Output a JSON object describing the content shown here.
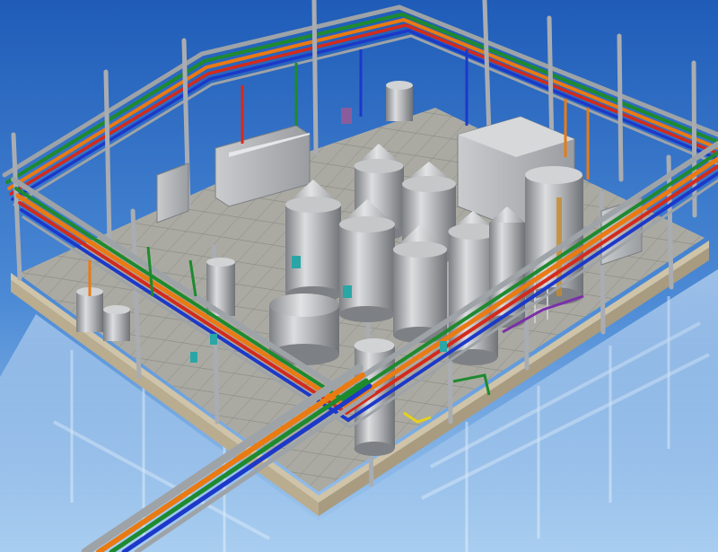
{
  "scene": {
    "subject": "3d-industrial-plant-render",
    "palette": {
      "sky_top": "#1f5cb8",
      "sky_bottom": "#9cc7ee",
      "floor_tile": "#a9a9a2",
      "floor_grout": "#8d8d86",
      "slab_edge": "#cfc3a8",
      "tank_light": "#d9dadb",
      "tank_mid": "#a8aaad",
      "tank_dark": "#7d8084",
      "pipe_steel": "#9ea3a8",
      "pipe_green": "#1e8a2e",
      "pipe_red": "#d42a1c",
      "pipe_blue": "#1c39c9",
      "pipe_orange": "#ea7a12",
      "pipe_purple": "#7a2fa8",
      "pipe_yellow": "#e5d21c",
      "reflection": "#cfe3f6"
    }
  }
}
